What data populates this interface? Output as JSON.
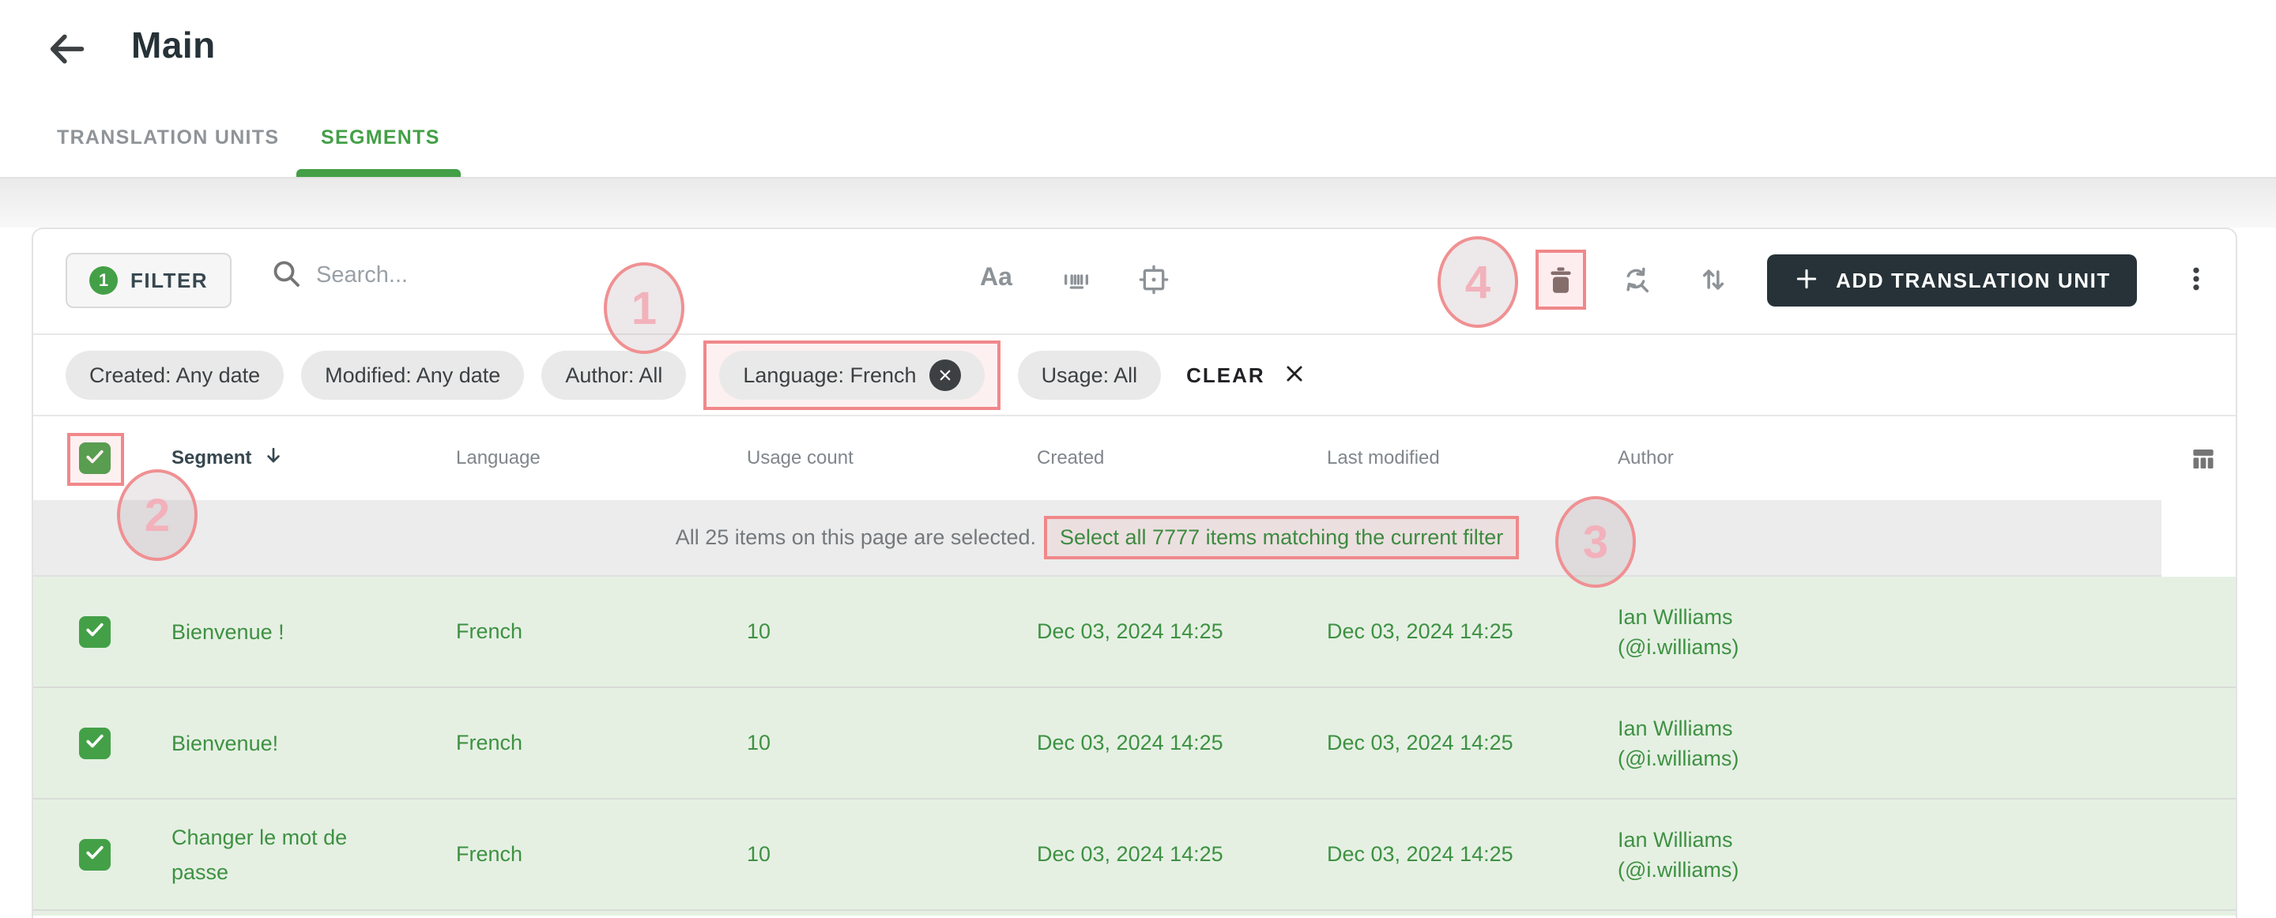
{
  "header": {
    "title": "Main"
  },
  "tabs": {
    "translation_units": "TRANSLATION UNITS",
    "segments": "SEGMENTS"
  },
  "toolbar": {
    "filter_label": "FILTER",
    "filter_count": "1",
    "search_placeholder": "Search...",
    "match_case_label": "Aa",
    "add_button_label": "ADD TRANSLATION UNIT"
  },
  "filters": {
    "chips": [
      {
        "label": "Created: Any date"
      },
      {
        "label": "Modified: Any date"
      },
      {
        "label": "Author: All"
      },
      {
        "label": "Language: French",
        "removable": true
      },
      {
        "label": "Usage: All"
      }
    ],
    "clear_label": "CLEAR"
  },
  "table": {
    "columns": {
      "segment": "Segment",
      "language": "Language",
      "usage_count": "Usage count",
      "created": "Created",
      "last_modified": "Last modified",
      "author": "Author"
    },
    "selection_banner": {
      "selected_text": "All 25 items on this page are selected.",
      "link_text": "Select all 7777 items matching the current filter"
    },
    "rows": [
      {
        "segment": "Bienvenue !",
        "language": "French",
        "usage_count": "10",
        "created": "Dec 03, 2024 14:25",
        "last_modified": "Dec 03, 2024 14:25",
        "author_name": "Ian Williams",
        "author_handle": "(@i.williams)"
      },
      {
        "segment": "Bienvenue!",
        "language": "French",
        "usage_count": "10",
        "created": "Dec 03, 2024 14:25",
        "last_modified": "Dec 03, 2024 14:25",
        "author_name": "Ian Williams",
        "author_handle": "(@i.williams)"
      },
      {
        "segment": "Changer le mot de passe",
        "language": "French",
        "usage_count": "10",
        "created": "Dec 03, 2024 14:25",
        "last_modified": "Dec 03, 2024 14:25",
        "author_name": "Ian Williams",
        "author_handle": "(@i.williams)"
      }
    ]
  },
  "annotations": {
    "n1": "1",
    "n2": "2",
    "n3": "3",
    "n4": "4"
  },
  "icons": {
    "back": "arrow-left",
    "search": "magnifier",
    "match_case": "Aa-text",
    "whole_word": "barcode-underline",
    "selection_frame": "crop-frame-with-dot",
    "delete": "trash-can",
    "find_replace": "circular-arrows",
    "sort": "arrows-up-down",
    "add": "plus",
    "more": "kebab-vertical",
    "columns": "table-columns",
    "segment_sort": "arrow-down",
    "chip_remove": "x-in-circle",
    "clear": "x-mark",
    "checkbox_checked": "green-checkmark"
  },
  "colors": {
    "accent_green": "#43A047",
    "row_text_green": "#3E9142",
    "selected_row_bg": "#E5F0E3",
    "dark_button": "#263238",
    "annotation_red": "#F0888A",
    "chip_bg": "#E9E9E9",
    "banner_bg": "#ECECEC"
  }
}
